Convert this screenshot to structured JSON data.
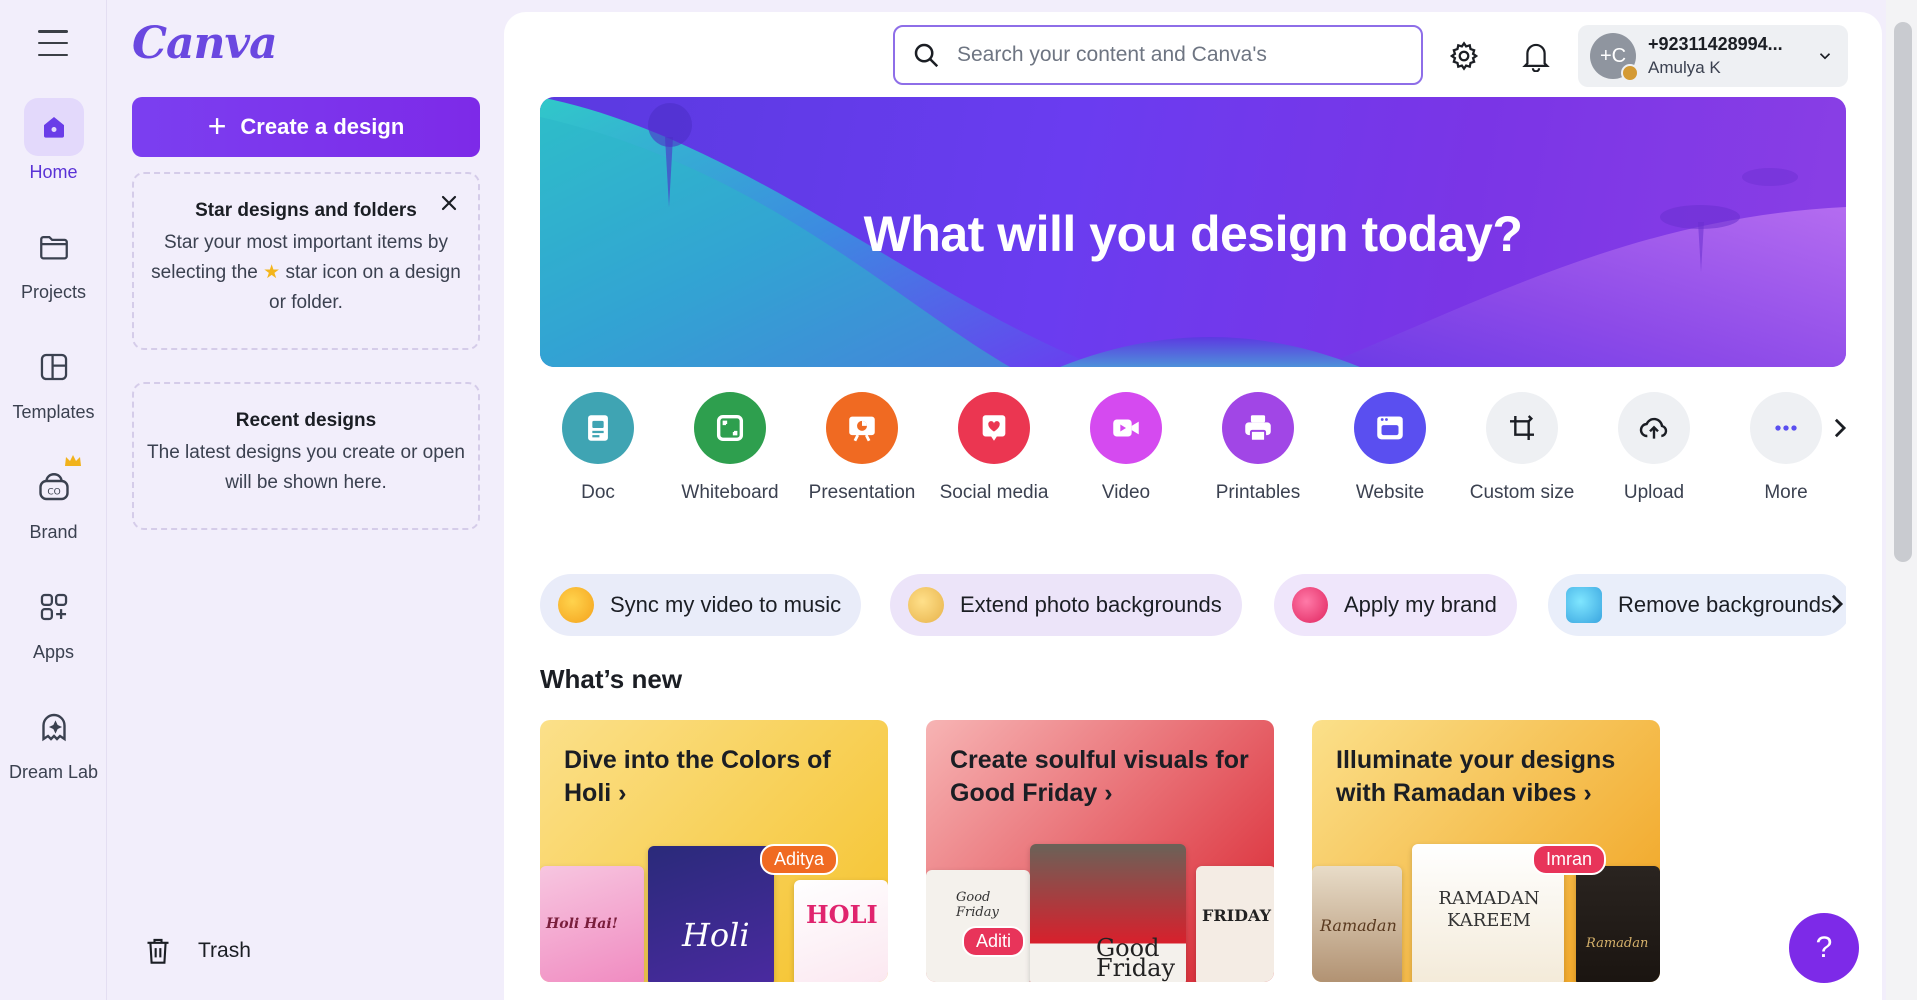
{
  "rail": {
    "items": [
      {
        "label": "Home",
        "icon": "home-icon"
      },
      {
        "label": "Projects",
        "icon": "folder-icon"
      },
      {
        "label": "Templates",
        "icon": "templates-icon"
      },
      {
        "label": "Brand",
        "icon": "brand-icon"
      },
      {
        "label": "Apps",
        "icon": "apps-icon"
      },
      {
        "label": "Dream Lab",
        "icon": "dream-lab-icon"
      }
    ]
  },
  "panel": {
    "logo": "Canva",
    "create_label": "Create a design",
    "star_card": {
      "title": "Star designs and folders",
      "body_line1": "Star your most important items by",
      "body_line2_pre": "selecting the",
      "body_line2_post": "star icon on a design",
      "body_line3": "or folder."
    },
    "recent_card": {
      "title": "Recent designs",
      "body": "The latest designs you create or open will be shown here."
    },
    "trash_label": "Trash"
  },
  "header": {
    "search_placeholder": "Search your content and Canva's",
    "account": {
      "initials": "+C",
      "phone": "+92311428994...",
      "name": "Amulya K"
    }
  },
  "hero": {
    "title": "What will you design today?"
  },
  "shortcuts": [
    {
      "label": "Doc",
      "color": "#3fa4b3",
      "icon": "doc-icon"
    },
    {
      "label": "Whiteboard",
      "color": "#2e9f4e",
      "icon": "whiteboard-icon"
    },
    {
      "label": "Presentation",
      "color": "#f06a22",
      "icon": "presentation-icon"
    },
    {
      "label": "Social media",
      "color": "#eb3651",
      "icon": "social-media-icon"
    },
    {
      "label": "Video",
      "color": "#d54af0",
      "icon": "video-icon"
    },
    {
      "label": "Printables",
      "color": "#a146e6",
      "icon": "printables-icon"
    },
    {
      "label": "Website",
      "color": "#5a4ff0",
      "icon": "website-icon"
    },
    {
      "label": "Custom size",
      "color": "#eef0f3",
      "icon": "custom-size-icon"
    },
    {
      "label": "Upload",
      "color": "#eef0f3",
      "icon": "upload-icon"
    },
    {
      "label": "More",
      "color": "#eef0f3",
      "icon": "more-icon"
    }
  ],
  "pills": [
    {
      "label": "Sync my video to music",
      "bg": "#e9ecf9"
    },
    {
      "label": "Extend photo backgrounds",
      "bg": "#ece4f9"
    },
    {
      "label": "Apply my brand",
      "bg": "#efe6fb"
    },
    {
      "label": "Remove backgrounds",
      "bg": "#e9eefa"
    }
  ],
  "whats_new": {
    "title": "What’s new",
    "cards": [
      {
        "title": "Dive into the Colors of Holi",
        "tag": "Aditya",
        "thumb1": "Holi Hai!",
        "thumb2": "Holi",
        "thumb3": "HOLI"
      },
      {
        "title": "Create soulful visuals for Good Friday",
        "tag": "Aditi",
        "thumb1": "Good Friday",
        "thumb2": "Good Friday",
        "thumb3": "FRIDAY"
      },
      {
        "title": "Illuminate your designs with Ramadan vibes",
        "tag": "Imran",
        "thumb1": "Ramadan",
        "thumb2": "RAMADAN KAREEM",
        "thumb3": "Ramadan"
      }
    ]
  },
  "help_label": "?"
}
